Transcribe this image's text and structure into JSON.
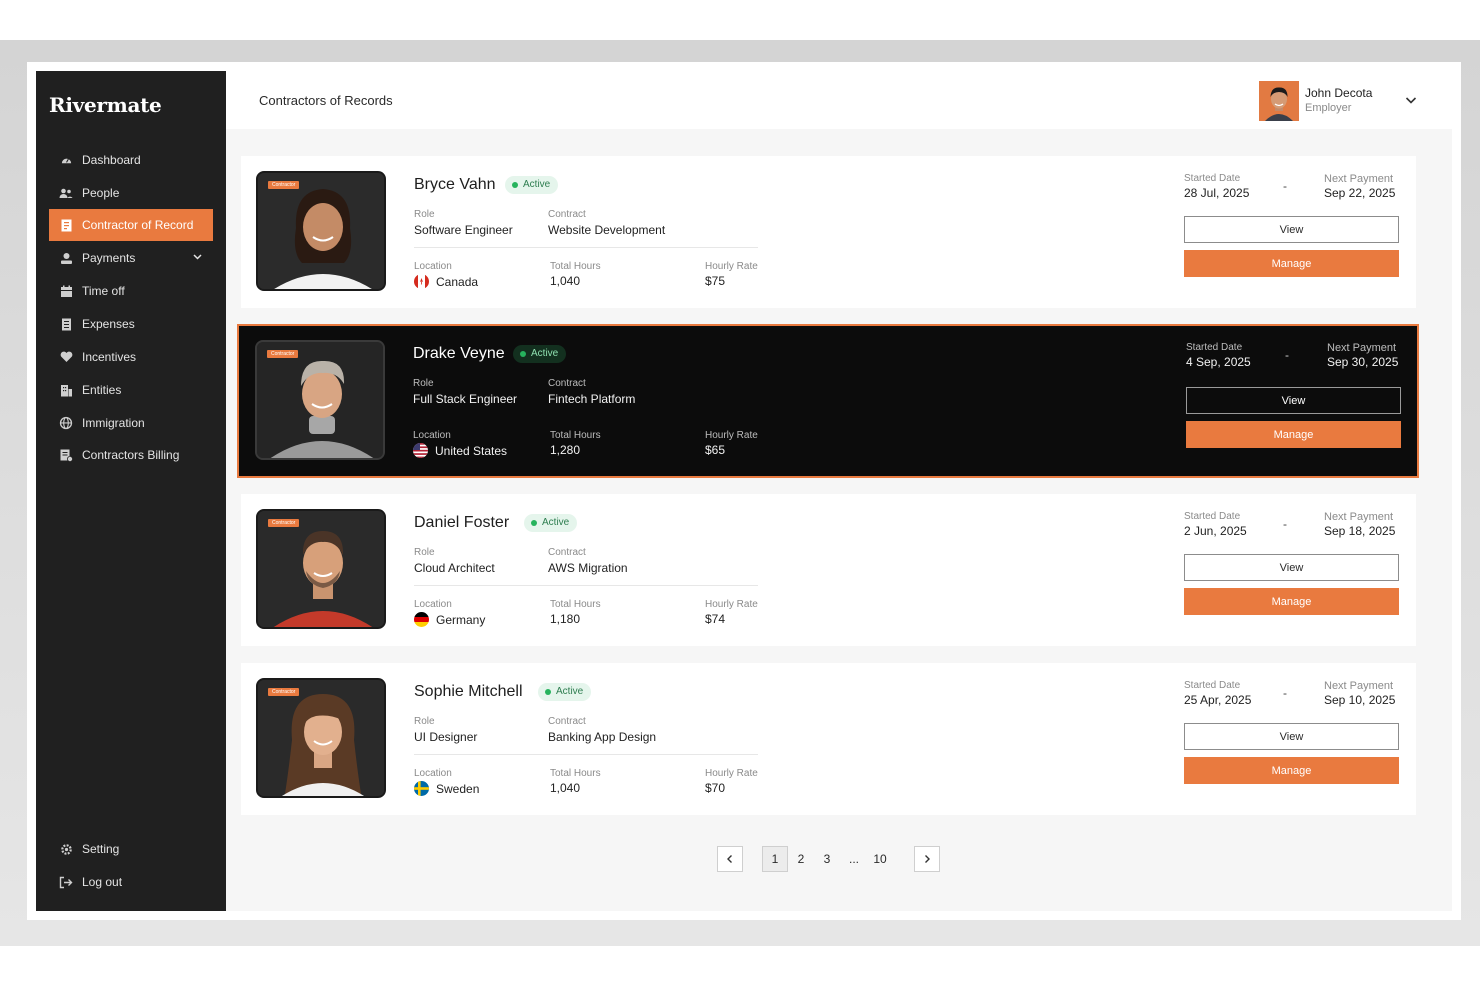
{
  "app": {
    "brand": "Rivermate"
  },
  "sidebar": {
    "items": [
      {
        "label": "Dashboard",
        "icon": "dashboard-icon"
      },
      {
        "label": "People",
        "icon": "people-icon"
      },
      {
        "label": "Contractor of Record",
        "icon": "document-icon",
        "active": true
      },
      {
        "label": "Payments",
        "icon": "payments-icon",
        "has_submenu": true
      },
      {
        "label": "Time off",
        "icon": "calendar-icon"
      },
      {
        "label": "Expenses",
        "icon": "receipt-icon"
      },
      {
        "label": "Incentives",
        "icon": "heart-icon"
      },
      {
        "label": "Entities",
        "icon": "building-icon"
      },
      {
        "label": "Immigration",
        "icon": "globe-icon"
      },
      {
        "label": "Contractors Billing",
        "icon": "billing-icon"
      }
    ],
    "bottom_items": [
      {
        "label": "Setting",
        "icon": "gear-icon"
      },
      {
        "label": "Log out",
        "icon": "logout-icon"
      }
    ]
  },
  "header": {
    "title": "Contractors of Records",
    "user": {
      "name": "John Decota",
      "role": "Employer"
    }
  },
  "labels": {
    "tag": "Contractor",
    "role": "Role",
    "contract": "Contract",
    "location": "Location",
    "total_hours": "Total Hours",
    "hourly_rate": "Hourly Rate",
    "started_date": "Started Date",
    "next_payment": "Next Payment",
    "dash": "-",
    "view": "View",
    "manage": "Manage"
  },
  "contractors": [
    {
      "name": "Bryce Vahn",
      "status": "Active",
      "role": "Software Engineer",
      "contract": "Website Development",
      "location": "Canada",
      "flag": "canada-flag-icon",
      "total_hours": "1,040",
      "hourly_rate": "$75",
      "started_date": "28 Jul, 2025",
      "next_payment": "Sep 22, 2025",
      "highlighted": false
    },
    {
      "name": "Drake Veyne",
      "status": "Active",
      "role": "Full Stack Engineer",
      "contract": "Fintech Platform",
      "location": "United States",
      "flag": "usa-flag-icon",
      "total_hours": "1,280",
      "hourly_rate": "$65",
      "started_date": "4 Sep, 2025",
      "next_payment": "Sep 30, 2025",
      "highlighted": true
    },
    {
      "name": "Daniel Foster",
      "status": "Active",
      "role": "Cloud Architect",
      "contract": "AWS Migration",
      "location": "Germany",
      "flag": "germany-flag-icon",
      "total_hours": "1,180",
      "hourly_rate": "$74",
      "started_date": "2 Jun, 2025",
      "next_payment": "Sep 18, 2025",
      "highlighted": false
    },
    {
      "name": "Sophie Mitchell",
      "status": "Active",
      "role": "UI Designer",
      "contract": "Banking App Design",
      "location": "Sweden",
      "flag": "sweden-flag-icon",
      "total_hours": "1,040",
      "hourly_rate": "$70",
      "started_date": "25 Apr, 2025",
      "next_payment": "Sep 10, 2025",
      "highlighted": false
    }
  ],
  "pagination": {
    "pages": [
      "1",
      "2",
      "3",
      "...",
      "10"
    ],
    "current": "1"
  },
  "colors": {
    "accent": "#e97a3f",
    "sidebar_bg": "#202020",
    "active_green": "#26b35d",
    "highlight_card_bg": "#0c0c0c"
  }
}
